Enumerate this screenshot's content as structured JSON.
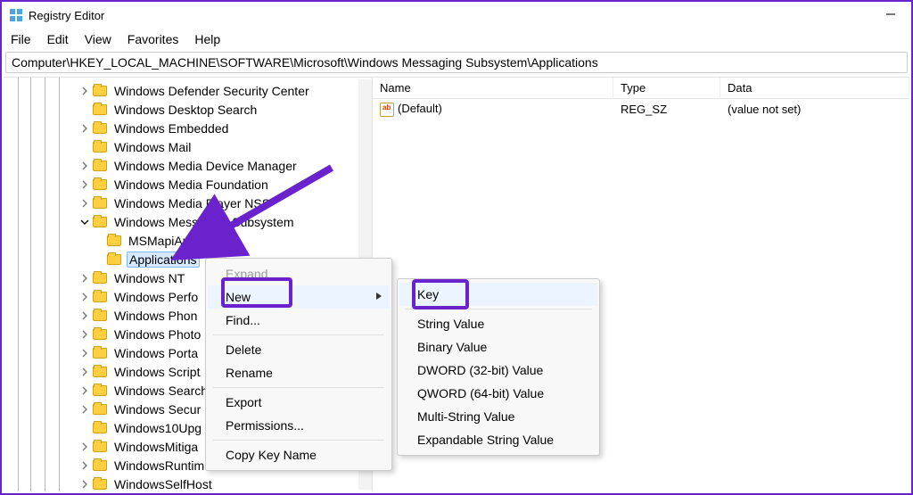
{
  "window": {
    "title": "Registry Editor"
  },
  "menu": {
    "file": "File",
    "edit": "Edit",
    "view": "View",
    "favorites": "Favorites",
    "help": "Help"
  },
  "address": "Computer\\HKEY_LOCAL_MACHINE\\SOFTWARE\\Microsoft\\Windows Messaging Subsystem\\Applications",
  "list": {
    "headers": {
      "name": "Name",
      "type": "Type",
      "data": "Data"
    },
    "rows": [
      {
        "name": "(Default)",
        "type": "REG_SZ",
        "data": "(value not set)"
      }
    ]
  },
  "tree": {
    "items": [
      {
        "indent": 5,
        "exp": "closed",
        "label": "Windows Defender Security Center"
      },
      {
        "indent": 5,
        "exp": "none",
        "label": "Windows Desktop Search"
      },
      {
        "indent": 5,
        "exp": "closed",
        "label": "Windows Embedded"
      },
      {
        "indent": 5,
        "exp": "none",
        "label": "Windows Mail"
      },
      {
        "indent": 5,
        "exp": "closed",
        "label": "Windows Media Device Manager"
      },
      {
        "indent": 5,
        "exp": "closed",
        "label": "Windows Media Foundation"
      },
      {
        "indent": 5,
        "exp": "closed",
        "label": "Windows Media Player NSS"
      },
      {
        "indent": 5,
        "exp": "open",
        "label": "Windows Messaging Subsystem"
      },
      {
        "indent": 6,
        "exp": "none",
        "label": "MSMapiApps"
      },
      {
        "indent": 6,
        "exp": "none",
        "label": "Applications",
        "selected": true
      },
      {
        "indent": 5,
        "exp": "closed",
        "label": "Windows NT"
      },
      {
        "indent": 5,
        "exp": "closed",
        "label": "Windows Perfo"
      },
      {
        "indent": 5,
        "exp": "closed",
        "label": "Windows Phon"
      },
      {
        "indent": 5,
        "exp": "closed",
        "label": "Windows Photo"
      },
      {
        "indent": 5,
        "exp": "closed",
        "label": "Windows Porta"
      },
      {
        "indent": 5,
        "exp": "closed",
        "label": "Windows Script"
      },
      {
        "indent": 5,
        "exp": "closed",
        "label": "Windows Search"
      },
      {
        "indent": 5,
        "exp": "closed",
        "label": "Windows Secur"
      },
      {
        "indent": 5,
        "exp": "none",
        "label": "Windows10Upg"
      },
      {
        "indent": 5,
        "exp": "closed",
        "label": "WindowsMitiga"
      },
      {
        "indent": 5,
        "exp": "closed",
        "label": "WindowsRuntim"
      },
      {
        "indent": 5,
        "exp": "closed",
        "label": "WindowsSelfHost"
      }
    ]
  },
  "context_menu": {
    "items": [
      {
        "label": "Expand",
        "disabled": true
      },
      {
        "label": "New",
        "submenu": true,
        "hover": true
      },
      {
        "label": "Find..."
      },
      {
        "sep": true
      },
      {
        "label": "Delete"
      },
      {
        "label": "Rename"
      },
      {
        "sep": true
      },
      {
        "label": "Export"
      },
      {
        "label": "Permissions..."
      },
      {
        "sep": true
      },
      {
        "label": "Copy Key Name"
      }
    ]
  },
  "submenu": {
    "items": [
      {
        "label": "Key",
        "hover": true
      },
      {
        "sep": true
      },
      {
        "label": "String Value"
      },
      {
        "label": "Binary Value"
      },
      {
        "label": "DWORD (32-bit) Value"
      },
      {
        "label": "QWORD (64-bit) Value"
      },
      {
        "label": "Multi-String Value"
      },
      {
        "label": "Expandable String Value"
      }
    ]
  }
}
